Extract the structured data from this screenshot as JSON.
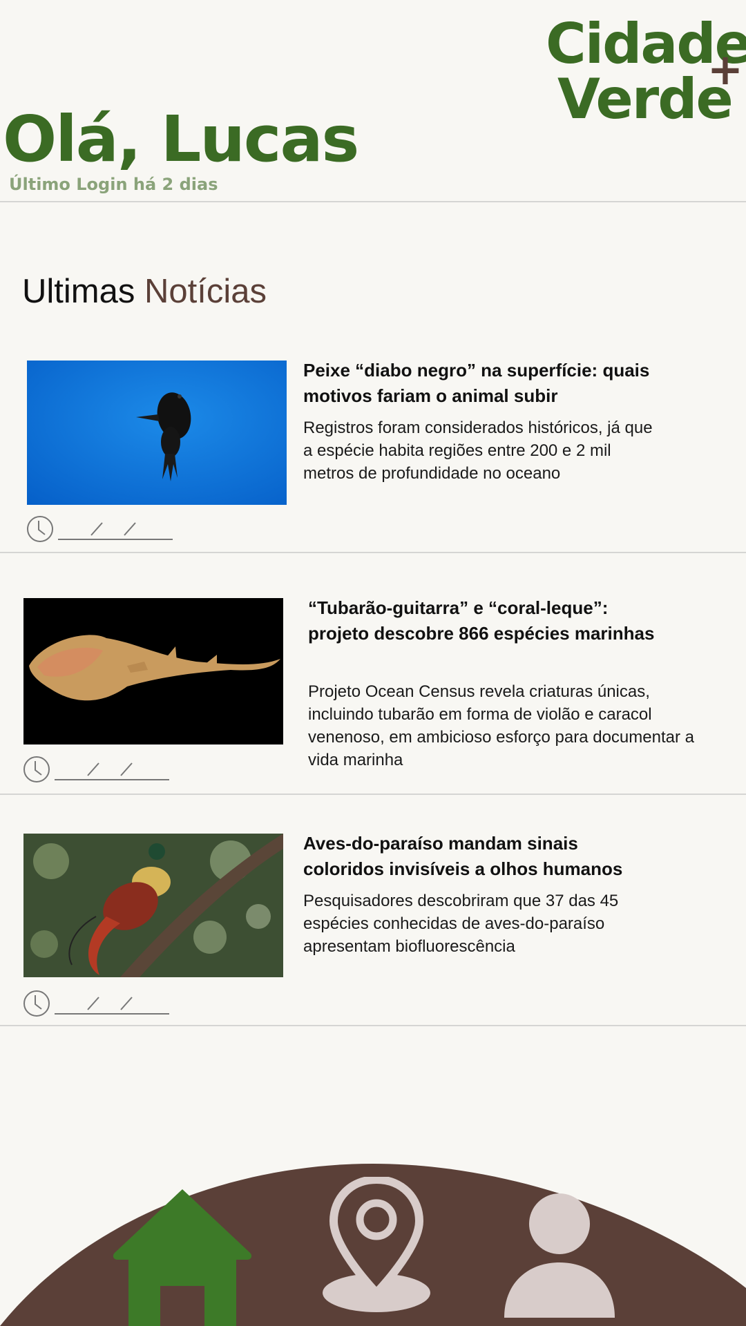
{
  "brand": {
    "line1": "Cidade",
    "line2": "Verde",
    "plus": "+"
  },
  "header": {
    "greeting": "Olá, Lucas",
    "last_login": "Último Login há 2 dias"
  },
  "section": {
    "title_part1": "Ultimas ",
    "title_part2": "Notícias"
  },
  "news": [
    {
      "title": "Peixe “diabo negro” na superfície: quais motivos fariam o animal subir",
      "description": "Registros foram considerados históricos, já que a espécie habita regiões entre 200 e 2 mil metros de profundidade no oceano",
      "date_placeholder": "/  /"
    },
    {
      "title": "“Tubarão-guitarra” e “coral-leque”: projeto descobre 866 espécies marinhas",
      "description": "Projeto Ocean Census revela criaturas únicas, incluindo tubarão em forma de violão e caracol venenoso, em ambicioso esforço para documentar a vida marinha",
      "date_placeholder": "/  /"
    },
    {
      "title": "Aves-do-paraíso mandam sinais coloridos invisíveis a olhos humanos",
      "description": "Pesquisadores descobriram que 37 das 45 espécies conhecidas de aves-do-paraíso apresentam biofluorescência",
      "date_placeholder": "/  /"
    }
  ],
  "nav": {
    "items": [
      {
        "icon": "home-icon",
        "active": true
      },
      {
        "icon": "map-pin-icon",
        "active": false
      },
      {
        "icon": "user-icon",
        "active": false
      }
    ]
  },
  "colors": {
    "background": "#f8f7f3",
    "brand_green": "#3b6b24",
    "brand_brown": "#5b4038",
    "muted_green": "#8aa37a",
    "nav_inactive": "#d8ccca"
  }
}
